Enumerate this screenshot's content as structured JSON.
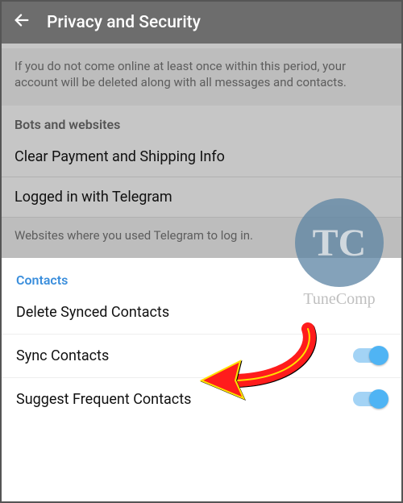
{
  "header": {
    "title": "Privacy and Security"
  },
  "dimmed": {
    "info1": "If you do not come online at least once within this period, your account will be deleted along with all messages and contacts.",
    "bots_header": "Bots and websites",
    "clear_payment": "Clear Payment and Shipping Info",
    "logged_in": "Logged in with Telegram",
    "info2": "Websites where you used Telegram to log in."
  },
  "contacts": {
    "header": "Contacts",
    "delete_synced": "Delete Synced Contacts",
    "sync": "Sync Contacts",
    "suggest": "Suggest Frequent Contacts"
  },
  "watermark": {
    "initials": "TC",
    "name": "TuneComp"
  }
}
